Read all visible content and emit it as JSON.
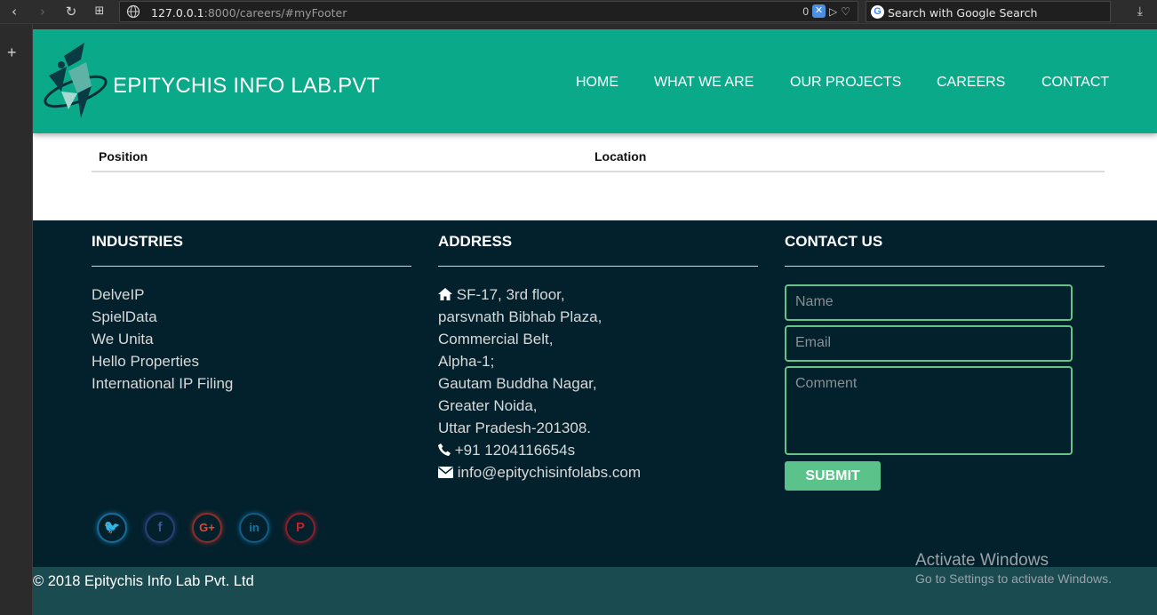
{
  "browser": {
    "url_host": "127.0.0.1",
    "url_rest": ":8000/careers/#myFooter",
    "badge_count": "0",
    "search_placeholder": "Search with Google Search"
  },
  "header": {
    "brand": "EPITYCHIS INFO LAB.PVT",
    "nav": [
      "HOME",
      "WHAT WE ARE",
      "OUR PROJECTS",
      "CAREERS",
      "CONTACT"
    ]
  },
  "table": {
    "columns": [
      "Position",
      "Location"
    ]
  },
  "footer": {
    "industries_title": "INDUSTRIES",
    "industries": [
      "DelveIP",
      "SpielData",
      "We Unita",
      "Hello Properties",
      "International IP Filing"
    ],
    "address_title": "ADDRESS",
    "address_lines": [
      "SF-17, 3rd floor,",
      "parsvnath Bibhab Plaza,",
      "Commercial Belt,",
      "Alpha-1;",
      "Gautam Buddha Nagar,",
      "Greater Noida,",
      "Uttar Pradesh-201308."
    ],
    "phone": "+91 1204116654s",
    "email": "info@epitychisinfolabs.com",
    "contact_title": "CONTACT US",
    "form": {
      "name_placeholder": "Name",
      "email_placeholder": "Email",
      "comment_placeholder": "Comment",
      "submit_label": "SUBMIT"
    },
    "copyright": "© 2018 Epitychis Info Lab Pvt. Ltd"
  },
  "watermark": {
    "line1": "Activate Windows",
    "line2": "Go to Settings to activate Windows."
  },
  "colors": {
    "header_bg": "#0aa98a",
    "footer_bg": "#02212c",
    "copyright_bg": "#1a4b51",
    "accent_green": "#5bc28a"
  }
}
